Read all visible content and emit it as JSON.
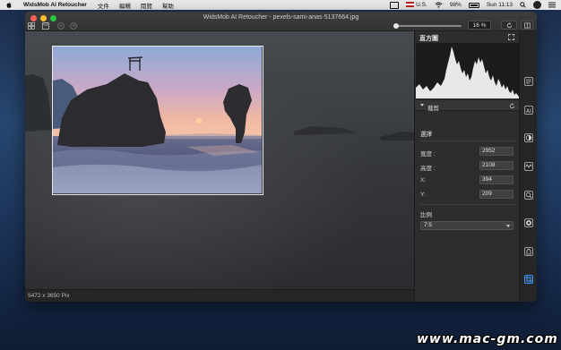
{
  "menubar": {
    "app_name": "WidsMob AI Retoucher",
    "menus": [
      "文件",
      "編輯",
      "閱覽",
      "幫助"
    ],
    "input_source": "U.S.",
    "battery": "98%",
    "clock": "Sun 11:13"
  },
  "window": {
    "title": "WidsMob AI Retoucher - pexels-sami-anas-5137664.jpg",
    "zoom": "16 %"
  },
  "status": {
    "dimensions": "5472 x 3650 Pix"
  },
  "panel": {
    "histogram_title": "直方圖",
    "section_title": "裁剪",
    "selection_label": "選擇",
    "fields": [
      {
        "label": "寬度 :",
        "value": "2952"
      },
      {
        "label": "高度 :",
        "value": "2108"
      },
      {
        "label": "X:",
        "value": "394"
      },
      {
        "label": "Y:",
        "value": "209"
      }
    ],
    "ratio_label": "比例",
    "ratio_value": "7:5"
  },
  "tools": [
    "histogram-tool-icon",
    "ai-tool-icon",
    "portrait-tool-icon",
    "noise-tool-icon",
    "zoom-tool-icon",
    "color-tool-icon",
    "retouch-tool-icon",
    "crop-tool-icon"
  ],
  "watermark": "www.mac-gm.com"
}
